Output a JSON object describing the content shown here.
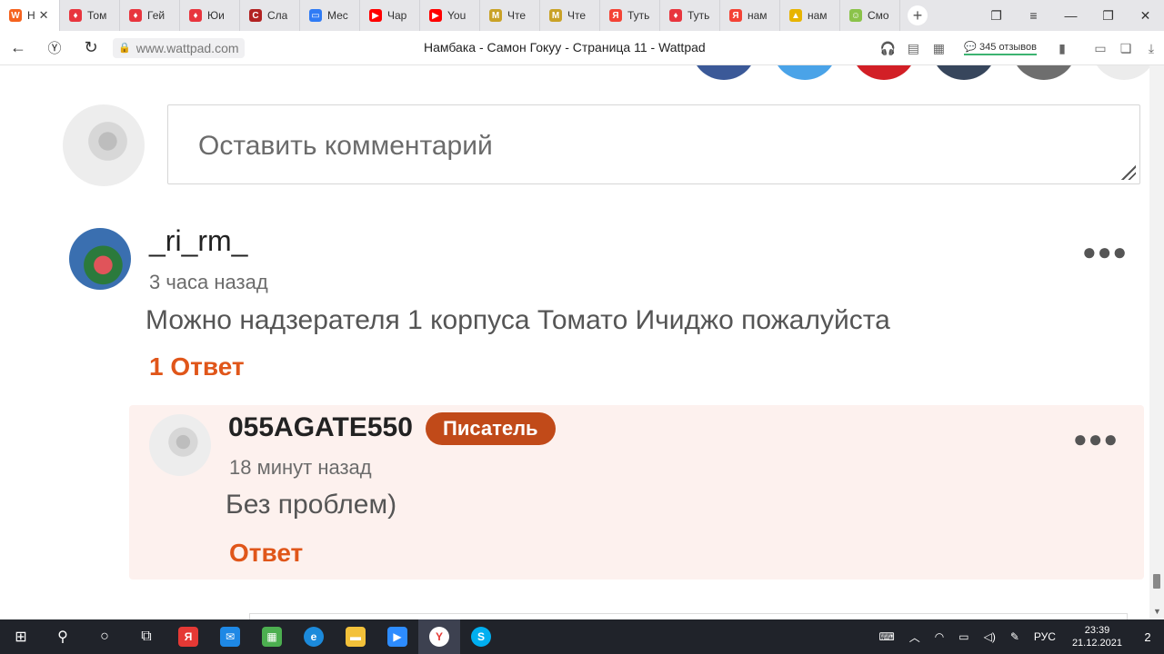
{
  "browser": {
    "tabs": [
      {
        "label": "Н",
        "favicon": "W",
        "color": "#f5631f",
        "active": true
      },
      {
        "label": "Том",
        "favicon": "flame",
        "color": "#e8353e"
      },
      {
        "label": "Гей",
        "favicon": "flame",
        "color": "#e8353e"
      },
      {
        "label": "Юи",
        "favicon": "flame",
        "color": "#e8353e"
      },
      {
        "label": "Сла",
        "favicon": "C",
        "color": "#b22222"
      },
      {
        "label": "Мес",
        "favicon": "msg",
        "color": "#2f7bf5"
      },
      {
        "label": "Чар",
        "favicon": "yt",
        "color": "#ff0000"
      },
      {
        "label": "You",
        "favicon": "yt",
        "color": "#ff0000"
      },
      {
        "label": "Чте",
        "favicon": "M",
        "color": "#c9a227"
      },
      {
        "label": "Чте",
        "favicon": "M",
        "color": "#c9a227"
      },
      {
        "label": "Туть",
        "favicon": "Я",
        "color": "#f44336"
      },
      {
        "label": "Туть",
        "favicon": "flame",
        "color": "#e8353e"
      },
      {
        "label": "нам",
        "favicon": "Я",
        "color": "#f44336"
      },
      {
        "label": "нам",
        "favicon": "img",
        "color": "#e7b400"
      },
      {
        "label": "Смо",
        "favicon": "smile",
        "color": "#8bc34a"
      }
    ],
    "url": "www.wattpad.com",
    "page_title": "Намбака - Самон Гокуу - Страница 11 - Wattpad",
    "reviews_label": "345 отзывов"
  },
  "comment_input": {
    "placeholder": "Оставить комментарий"
  },
  "comments": [
    {
      "username": "_ri_rm_",
      "time": "3 часа назад",
      "text": "Можно надзерателя 1 корпуса Томато Ичиджо пожалуйста",
      "reply_link": "1 Ответ"
    }
  ],
  "reply": {
    "username": "055AGATE550",
    "badge": "Писатель",
    "time": "18 минут назад",
    "text": "Без проблем)",
    "reply_link": "Ответ"
  },
  "taskbar": {
    "language": "РУС",
    "time": "23:39",
    "date": "21.12.2021",
    "notifications": "2"
  },
  "colors": {
    "accent": "#e0561a",
    "badge": "#c14a19",
    "reply_bg": "#fdf1ee"
  }
}
